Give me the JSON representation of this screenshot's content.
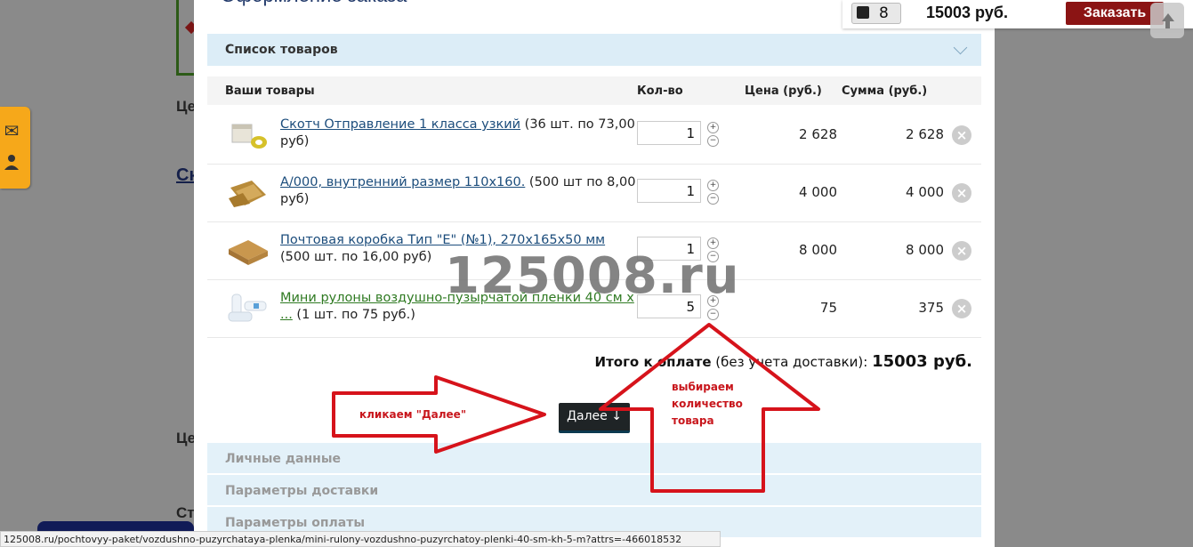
{
  "modal_title": "Оформление заказа",
  "cart_bar": {
    "count": "8",
    "total": "15003 руб.",
    "order_label": "Заказать"
  },
  "background": {
    "label_price_1": "Це",
    "label_price_2": "Це",
    "label_link": "Ск",
    "label_status": "Ст"
  },
  "sections": {
    "products": "Список товаров",
    "personal": "Личные данные",
    "delivery": "Параметры доставки",
    "payment": "Параметры оплаты"
  },
  "table": {
    "headers": {
      "item": "Ваши товары",
      "qty": "Кол-во",
      "price": "Цена (руб.)",
      "sum": "Сумма (руб.)"
    },
    "rows": [
      {
        "link": "Скотч Отправление 1 класса узкий",
        "note": " (36 шт. по 73,00 руб)",
        "qty": "1",
        "price": "2 628",
        "sum": "2 628"
      },
      {
        "link": "A/000, внутренний размер 110x160.",
        "note": " (500 шт по 8,00 руб)",
        "qty": "1",
        "price": "4 000",
        "sum": "4 000"
      },
      {
        "link": "Почтовая коробка Тип \"Е\" (№1), 270x165x50 мм",
        "note": " (500 шт. по 16,00 руб)",
        "qty": "1",
        "price": "8 000",
        "sum": "8 000"
      },
      {
        "link": "Мини рулоны воздушно-пузырчатой пленки 40 см х ...",
        "note": " (1 шт. по 75 руб.)",
        "qty": "5",
        "price": "75",
        "sum": "375"
      }
    ],
    "plus": "+",
    "minus": "−",
    "remove": "×"
  },
  "total": {
    "label": "Итого к оплате",
    "note": " (без учета доставки): ",
    "amount": "15003 руб."
  },
  "next_button": "Далее ↓",
  "watermark": "125008.ru",
  "annotations": {
    "click_next": "кликаем \"Далее\"",
    "choose_qty_1": "выбираем",
    "choose_qty_2": "количество",
    "choose_qty_3": "товара"
  },
  "status_url": "125008.ru/pochtovyy-paket/vozdushno-puzyrchataya-plenka/mini-rulony-vozdushno-puzyrchatoy-plenki-40-sm-kh-5-m?attrs=-466018532",
  "colors": {
    "accent_red": "#c8161c",
    "order_button": "#8b1414",
    "section_bg": "#dcedf7"
  }
}
